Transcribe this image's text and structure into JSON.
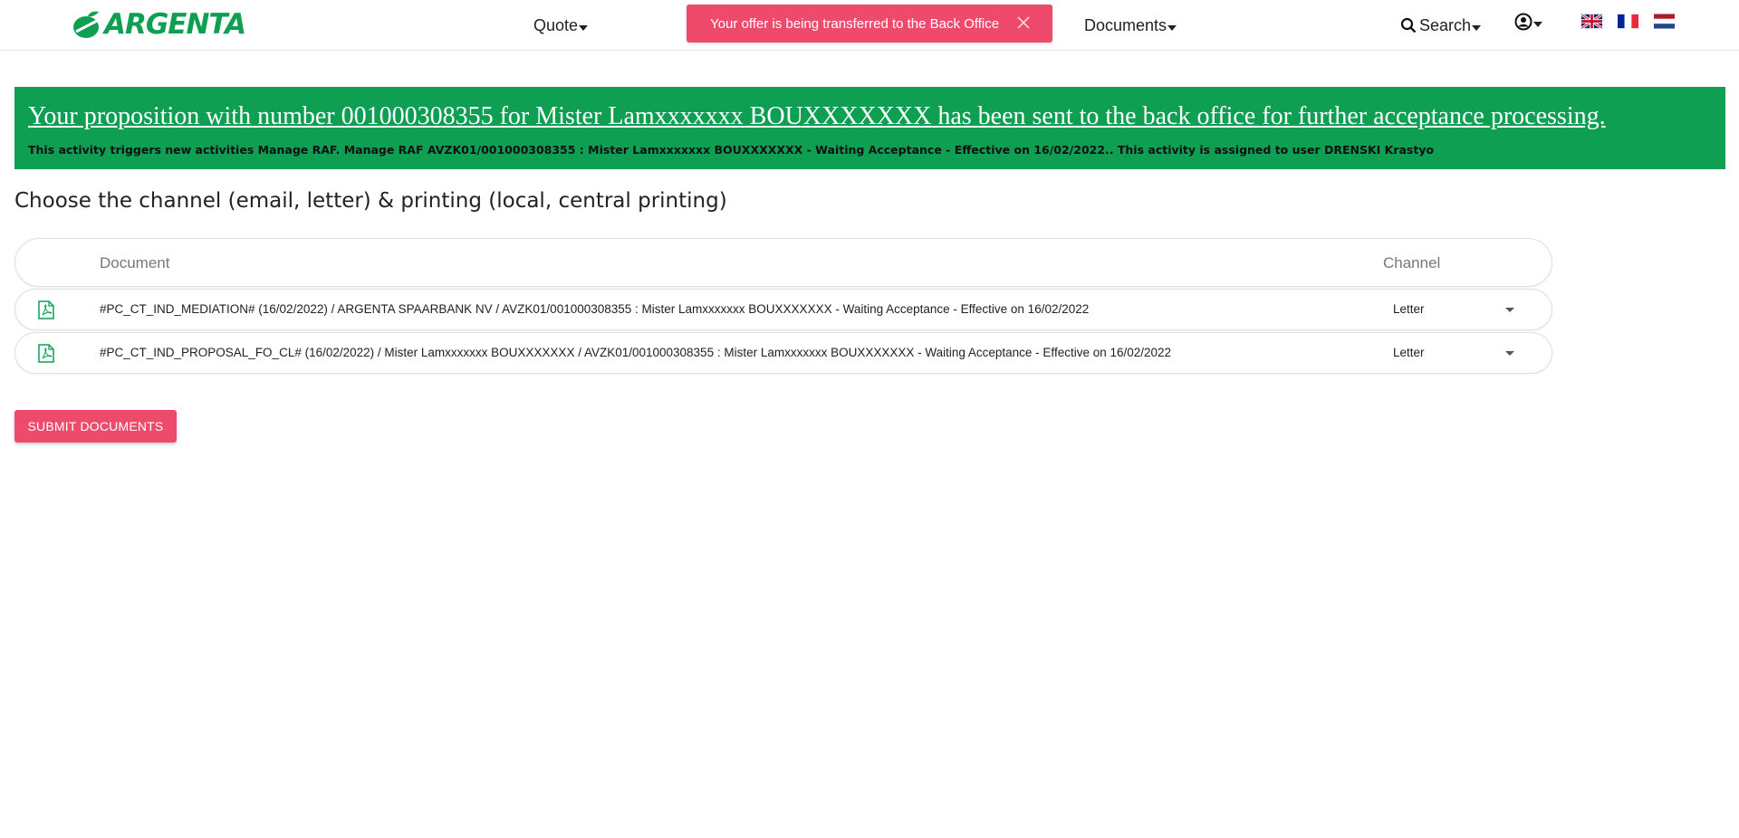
{
  "header": {
    "brand": "ARGENTA",
    "nav": {
      "quote_label": "Quote",
      "documents_label": "Documents",
      "search_label": "Search"
    },
    "toast_message": "Your offer is being transferred to the Back Office",
    "languages": [
      "uk-flag",
      "fr-flag",
      "nl-flag"
    ]
  },
  "banner": {
    "title": "Your proposition with number 001000308355 for Mister Lamxxxxxxx BOUXXXXXXX has been sent to the back office for further acceptance processing.",
    "subtitle": "This activity triggers new activities Manage RAF. Manage RAF AVZK01/001000308355 : Mister Lamxxxxxxx BOUXXXXXXX - Waiting Acceptance - Effective on 16/02/2022.. This activity is assigned to user DRENSKI Krastyo"
  },
  "section_title": "Choose the channel (email, letter) & printing (local, central printing)",
  "table": {
    "headers": {
      "document": "Document",
      "channel": "Channel"
    },
    "rows": [
      {
        "document": "#PC_CT_IND_MEDIATION# (16/02/2022) / ARGENTA SPAARBANK NV / AVZK01/001000308355 : Mister Lamxxxxxxx BOUXXXXXXX - Waiting Acceptance - Effective on 16/02/2022",
        "channel": "Letter"
      },
      {
        "document": "#PC_CT_IND_PROPOSAL_FO_CL# (16/02/2022) / Mister Lamxxxxxxx BOUXXXXXXX / AVZK01/001000308355 : Mister Lamxxxxxxx BOUXXXXXXX - Waiting Acceptance - Effective on 16/02/2022",
        "channel": "Letter"
      }
    ]
  },
  "submit_label": "SUBMIT DOCUMENTS",
  "colors": {
    "brand_green": "#0e9f53",
    "accent_pink": "#ee4b6c"
  }
}
